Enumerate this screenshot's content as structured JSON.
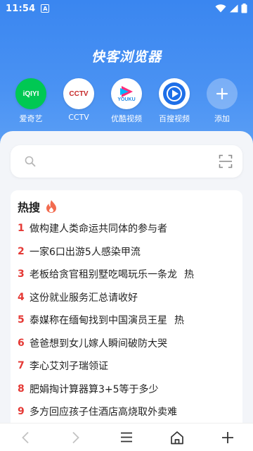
{
  "status_bar": {
    "time": "11:54",
    "notification_glyph": "A"
  },
  "header": {
    "title": "快客浏览器"
  },
  "shortcuts": [
    {
      "label": "爱奇艺",
      "logo_text": "iQIYI",
      "icon": "iqiyi-logo"
    },
    {
      "label": "CCTV",
      "logo_text": "CCTV",
      "icon": "cctv-logo"
    },
    {
      "label": "优酷视频",
      "logo_text": "YOUKU",
      "icon": "youku-logo"
    },
    {
      "label": "百搜视频",
      "icon": "baisou-video-logo"
    },
    {
      "label": "添加",
      "icon": "plus-icon"
    }
  ],
  "search": {
    "placeholder": ""
  },
  "hot_search": {
    "title": "热搜",
    "items": [
      {
        "rank": "1",
        "text": "做构建人类命运共同体的参与者",
        "badge": ""
      },
      {
        "rank": "2",
        "text": "一家6口出游5人感染甲流",
        "badge": ""
      },
      {
        "rank": "3",
        "text": "老板给贪官租别墅吃喝玩乐一条龙",
        "badge": "热"
      },
      {
        "rank": "4",
        "text": "这份就业服务汇总请收好",
        "badge": ""
      },
      {
        "rank": "5",
        "text": "泰媒称在缅甸找到中国演员王星",
        "badge": "热"
      },
      {
        "rank": "6",
        "text": "爸爸想到女儿嫁人瞬间破防大哭",
        "badge": ""
      },
      {
        "rank": "7",
        "text": "李心艾刘子瑞领证",
        "badge": ""
      },
      {
        "rank": "8",
        "text": "肥娟掏计算器算3+5等于多少",
        "badge": ""
      },
      {
        "rank": "9",
        "text": "多方回应孩子住酒店高烧取外卖难",
        "badge": ""
      }
    ]
  },
  "colors": {
    "accent": "#3a86f0",
    "rank": "#e53935",
    "flame": "#f26b4f"
  }
}
